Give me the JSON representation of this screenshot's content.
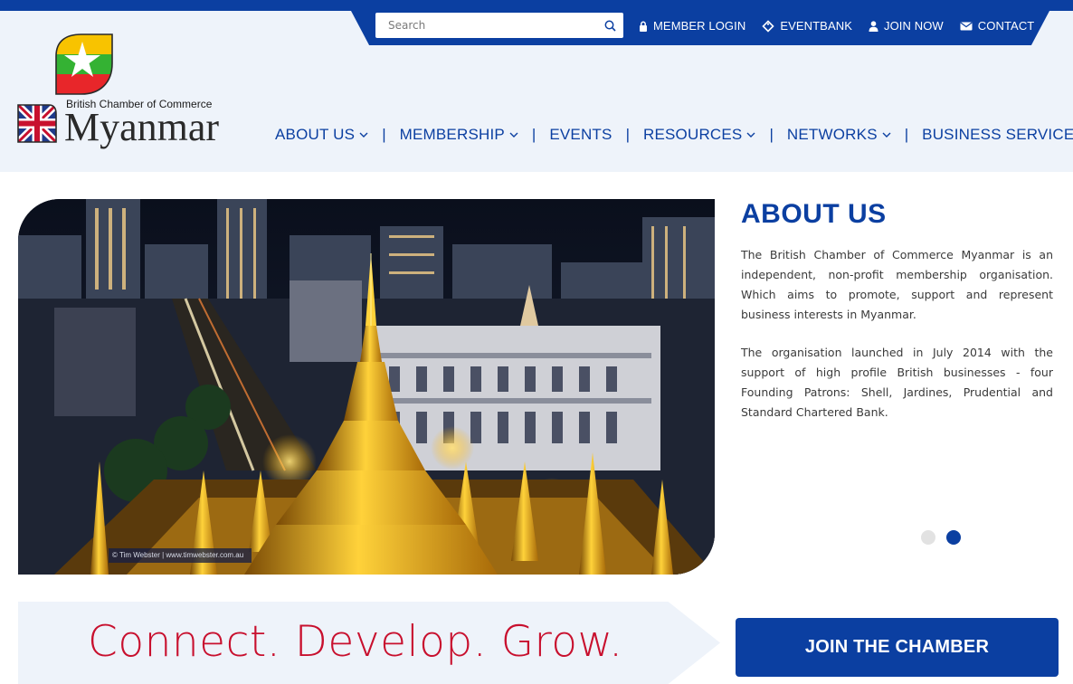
{
  "search": {
    "placeholder": "Search"
  },
  "utility_links": [
    {
      "label": "MEMBER LOGIN",
      "icon": "lock-icon"
    },
    {
      "label": "EVENTBANK",
      "icon": "tag-icon"
    },
    {
      "label": "JOIN NOW",
      "icon": "user-icon"
    },
    {
      "label": "CONTACT",
      "icon": "envelope-icon"
    }
  ],
  "logo": {
    "small_text": "British Chamber of Commerce",
    "big_text": "Myanmar"
  },
  "nav": [
    {
      "label": "ABOUT US",
      "dropdown": true
    },
    {
      "label": "MEMBERSHIP",
      "dropdown": true
    },
    {
      "label": "EVENTS",
      "dropdown": false
    },
    {
      "label": "RESOURCES",
      "dropdown": true
    },
    {
      "label": "NETWORKS",
      "dropdown": true
    },
    {
      "label": "BUSINESS SERVICES",
      "dropdown": true
    }
  ],
  "hero": {
    "credit": "© Tim Webster | www.timwebster.com.au"
  },
  "about": {
    "title": "ABOUT US",
    "paragraphs": [
      "The British Chamber of Commerce Myanmar is an independent, non-profit membership organisation. Which aims to promote, support and represent business interests in Myanmar.",
      "The organisation launched in July 2014 with the support of high profile British businesses - four Founding Patrons: Shell, Jardines, Prudential and Standard Chartered Bank."
    ]
  },
  "carousel": {
    "slides": 2,
    "active": 2
  },
  "tagline": "Connect. Develop. Grow.",
  "cta": {
    "label": "JOIN THE CHAMBER"
  },
  "colors": {
    "brand_blue": "#0b3fa1",
    "tagline_red": "#c8102e",
    "header_bg": "#eef3fa"
  }
}
